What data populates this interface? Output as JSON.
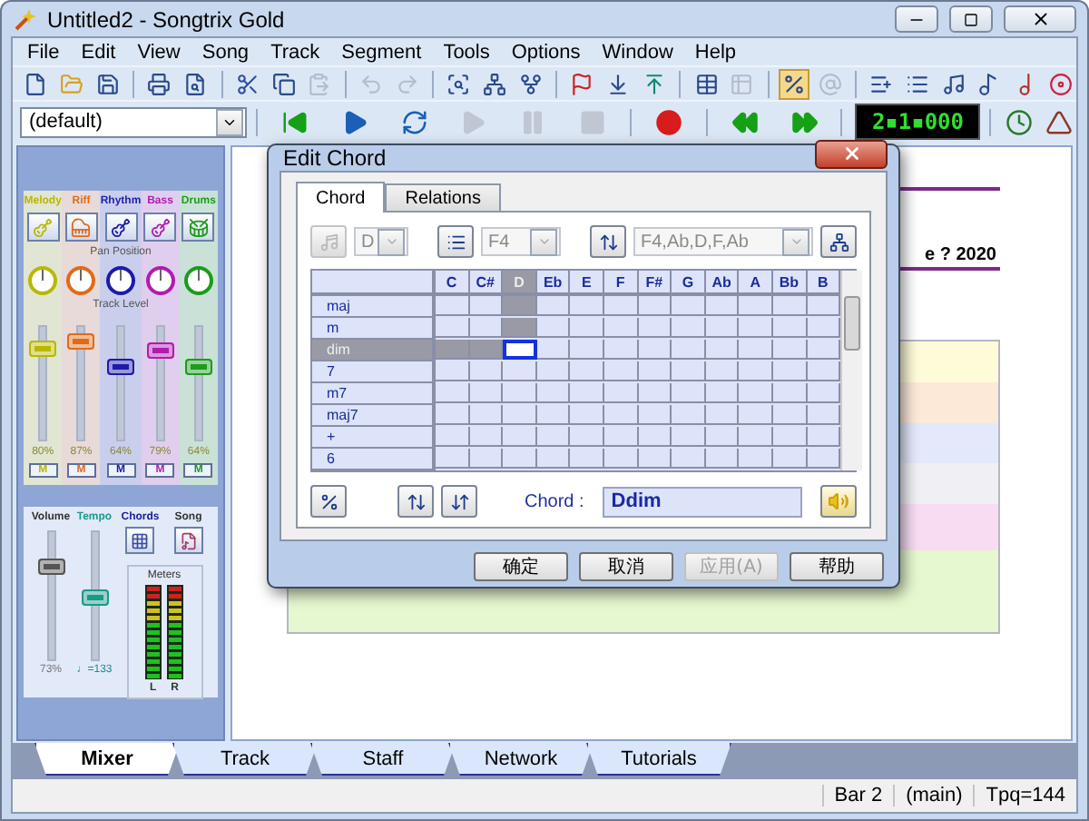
{
  "window": {
    "title": "Untitled2 - Songtrix Gold"
  },
  "menu": [
    "File",
    "Edit",
    "View",
    "Song",
    "Track",
    "Segment",
    "Tools",
    "Options",
    "Window",
    "Help"
  ],
  "toolbar": [
    {
      "kind": "new",
      "disabled": false
    },
    {
      "kind": "open",
      "disabled": false
    },
    {
      "kind": "save",
      "disabled": false
    },
    {
      "kind": "sep"
    },
    {
      "kind": "print",
      "disabled": false
    },
    {
      "kind": "preview",
      "disabled": false
    },
    {
      "kind": "sep"
    },
    {
      "kind": "cut",
      "disabled": false
    },
    {
      "kind": "copy",
      "disabled": false
    },
    {
      "kind": "paste",
      "disabled": true
    },
    {
      "kind": "sep"
    },
    {
      "kind": "undo",
      "disabled": true
    },
    {
      "kind": "redo",
      "disabled": true
    },
    {
      "kind": "sep"
    },
    {
      "kind": "inspect",
      "disabled": false
    },
    {
      "kind": "tree",
      "disabled": false
    },
    {
      "kind": "fork",
      "disabled": false
    },
    {
      "kind": "sep"
    },
    {
      "kind": "flag",
      "disabled": false
    },
    {
      "kind": "down",
      "disabled": false
    },
    {
      "kind": "up",
      "disabled": false
    },
    {
      "kind": "sep"
    },
    {
      "kind": "grid",
      "disabled": false
    },
    {
      "kind": "grid2",
      "disabled": true
    },
    {
      "kind": "sep"
    },
    {
      "kind": "fraction",
      "disabled": false,
      "pressed": true
    },
    {
      "kind": "at",
      "disabled": true
    },
    {
      "kind": "sep"
    },
    {
      "kind": "list-add",
      "disabled": false
    },
    {
      "kind": "list",
      "disabled": false
    },
    {
      "kind": "note",
      "disabled": false
    },
    {
      "kind": "note2",
      "disabled": false
    },
    {
      "kind": "note3",
      "disabled": false
    },
    {
      "kind": "disc",
      "disabled": false
    }
  ],
  "transport": {
    "style": {
      "value": "(default)"
    },
    "buttons": [
      {
        "kind": "sep"
      },
      {
        "kind": "start",
        "disabled": false
      },
      {
        "kind": "play",
        "disabled": false
      },
      {
        "kind": "loop",
        "disabled": false
      },
      {
        "kind": "play",
        "disabled": true
      },
      {
        "kind": "pause",
        "disabled": true
      },
      {
        "kind": "stop",
        "disabled": true
      },
      {
        "kind": "sep"
      },
      {
        "kind": "record",
        "disabled": false
      },
      {
        "kind": "sep"
      },
      {
        "kind": "rewind",
        "disabled": false
      },
      {
        "kind": "forward",
        "disabled": false
      },
      {
        "kind": "sep"
      }
    ],
    "position": "2▪1▪000"
  },
  "mixer": {
    "pan_label": "Pan Position",
    "level_label": "Track Level",
    "tracks": [
      {
        "name": "Melody",
        "color": "#b8b800",
        "level": 0.8,
        "reading": "80%",
        "mute": "M"
      },
      {
        "name": "Riff",
        "color": "#e06a1c",
        "level": 0.87,
        "reading": "87%",
        "mute": "M"
      },
      {
        "name": "Rhythm",
        "color": "#1c1ca8",
        "level": 0.64,
        "reading": "64%",
        "mute": "M"
      },
      {
        "name": "Bass",
        "color": "#b01cb0",
        "level": 0.79,
        "reading": "79%",
        "mute": "M"
      },
      {
        "name": "Drums",
        "color": "#1c9c1c",
        "level": 0.64,
        "reading": "64%",
        "mute": "M"
      }
    ],
    "volume": {
      "label": "Volume",
      "level": 0.73,
      "reading": "73%"
    },
    "tempo": {
      "label": "Tempo",
      "level": 0.48,
      "reading": "♩=133"
    },
    "chords": {
      "label": "Chords"
    },
    "song": {
      "label": "Song"
    },
    "meters": {
      "label": "Meters",
      "left": "L",
      "right": "R"
    }
  },
  "score": {
    "title_fragment": "e ? 2020"
  },
  "dialog": {
    "title": "Edit Chord",
    "tabs": [
      {
        "label": "Chord",
        "selected": true
      },
      {
        "label": "Relations",
        "selected": false
      }
    ],
    "root": {
      "value": "D"
    },
    "bass": {
      "value": "F4"
    },
    "notes": {
      "value": "F4,Ab,D,F,Ab"
    },
    "columns": [
      {
        "label": "C",
        "selected": false
      },
      {
        "label": "C#",
        "selected": false
      },
      {
        "label": "D",
        "selected": true
      },
      {
        "label": "Eb",
        "selected": false
      },
      {
        "label": "E",
        "selected": false
      },
      {
        "label": "F",
        "selected": false
      },
      {
        "label": "F#",
        "selected": false
      },
      {
        "label": "G",
        "selected": false
      },
      {
        "label": "Ab",
        "selected": false
      },
      {
        "label": "A",
        "selected": false
      },
      {
        "label": "Bb",
        "selected": false
      },
      {
        "label": "B",
        "selected": false
      }
    ],
    "rows": [
      {
        "label": "maj",
        "selected": false
      },
      {
        "label": "m",
        "selected": false
      },
      {
        "label": "dim",
        "selected": true
      },
      {
        "label": "7",
        "selected": false
      },
      {
        "label": "m7",
        "selected": false
      },
      {
        "label": "maj7",
        "selected": false
      },
      {
        "label": "+",
        "selected": false
      },
      {
        "label": "6",
        "selected": false
      }
    ],
    "chord_label": "Chord :",
    "chord": {
      "value": "Ddim"
    },
    "buttons": [
      {
        "label": "确定",
        "disabled": false
      },
      {
        "label": "取消",
        "disabled": false
      },
      {
        "label": "应用(A)",
        "disabled": true
      },
      {
        "label": "帮助",
        "disabled": false
      }
    ]
  },
  "bottom_tabs": [
    {
      "label": "Mixer",
      "selected": true
    },
    {
      "label": "Track",
      "selected": false
    },
    {
      "label": "Staff",
      "selected": false
    },
    {
      "label": "Network",
      "selected": false
    },
    {
      "label": "Tutorials",
      "selected": false
    }
  ],
  "status_bar": [
    "Bar 2",
    "(main)",
    "Tpq=144"
  ]
}
